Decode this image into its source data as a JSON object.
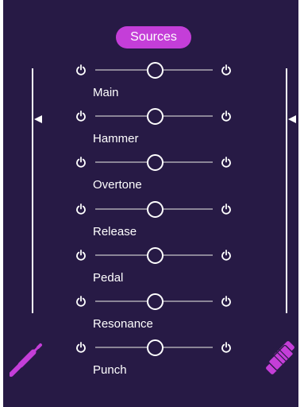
{
  "header": {
    "sources_label": "Sources"
  },
  "channels": [
    {
      "label": "Main",
      "level": 0.5
    },
    {
      "label": "Hammer",
      "level": 0.5
    },
    {
      "label": "Overtone",
      "level": 0.5
    },
    {
      "label": "Release",
      "level": 0.5
    },
    {
      "label": "Pedal",
      "level": 0.5
    },
    {
      "label": "Resonance",
      "level": 0.5
    },
    {
      "label": "Punch",
      "level": 0.5
    }
  ],
  "icons": {
    "power": "power-icon",
    "left_tool": "audio-cable-icon",
    "right_tool": "microphone-icon"
  },
  "colors": {
    "background": "#271a45",
    "accent": "#c43ed8",
    "text": "#ffffff",
    "track": "#8b8597"
  }
}
